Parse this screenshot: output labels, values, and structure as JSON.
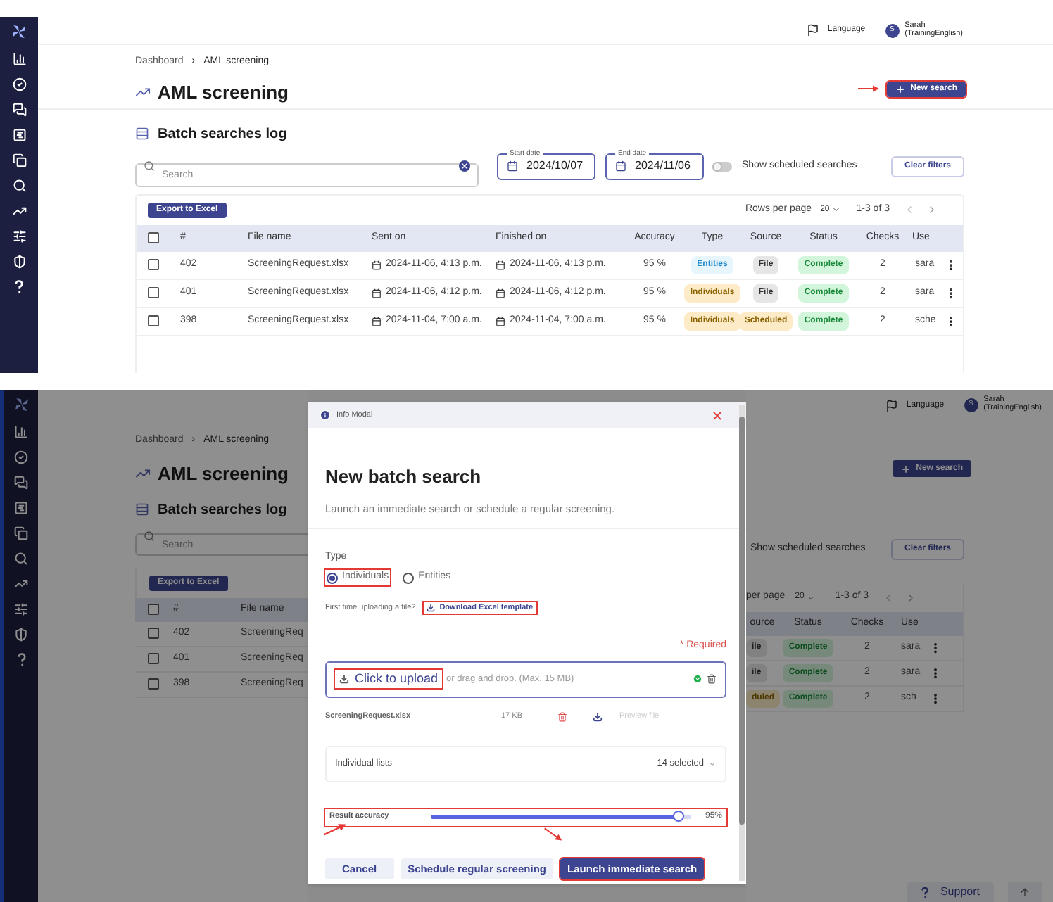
{
  "log_page": {
    "header": {
      "language": "Language",
      "user_initial": "S",
      "user_name": "Sarah",
      "user_org": "(TrainingEnglish)"
    },
    "breadcrumb": [
      "Dashboard",
      "›",
      "AML screening"
    ],
    "title": "AML screening",
    "new_search": {
      "label": "New search",
      "highlighted": true,
      "arrow": true
    },
    "section_title": "Batch searches log",
    "search": {
      "placeholder": "Search"
    },
    "start_date": {
      "label": "Start date",
      "value": "2024/10/07"
    },
    "end_date": {
      "label": "End date",
      "value": "2024/11/06"
    },
    "scheduled_toggle": {
      "label": "Show scheduled searches",
      "on": false
    },
    "clear_filters": "Clear filters",
    "export": "Export to Excel",
    "pagination": {
      "label": "Rows per page",
      "rows_per_page": "20",
      "range": "1-3 of 3"
    },
    "all_checked": false,
    "columns": [
      "#",
      "File name",
      "Sent on",
      "Finished on",
      "Accuracy",
      "Type",
      "Source",
      "Status",
      "Checks",
      "Use"
    ],
    "rows": [
      {
        "checked": false,
        "id": "402",
        "file": "ScreeningRequest.xlsx",
        "sent": "2024-11-06, 4:13 p.m.",
        "finished": "2024-11-06, 4:13 p.m.",
        "accuracy": "95 %",
        "type": {
          "label": "Entities",
          "kind": "entities"
        },
        "source": {
          "label": "File",
          "kind": "file"
        },
        "status": {
          "label": "Complete",
          "kind": "complete"
        },
        "checks": "2",
        "user": "sara"
      },
      {
        "checked": false,
        "id": "401",
        "file": "ScreeningRequest.xlsx",
        "sent": "2024-11-06, 4:12 p.m.",
        "finished": "2024-11-06, 4:12 p.m.",
        "accuracy": "95 %",
        "type": {
          "label": "Individuals",
          "kind": "individuals"
        },
        "source": {
          "label": "File",
          "kind": "file"
        },
        "status": {
          "label": "Complete",
          "kind": "complete"
        },
        "checks": "2",
        "user": "sara"
      },
      {
        "checked": false,
        "id": "398",
        "file": "ScreeningRequest.xlsx",
        "sent": "2024-11-04, 7:00 a.m.",
        "finished": "2024-11-04, 7:00 a.m.",
        "accuracy": "95 %",
        "type": {
          "label": "Individuals",
          "kind": "individuals"
        },
        "source": {
          "label": "Scheduled",
          "kind": "scheduled"
        },
        "status": {
          "label": "Complete",
          "kind": "complete"
        },
        "checks": "2",
        "user": "sche"
      }
    ]
  },
  "modal_view": {
    "left": {
      "breadcrumb": [
        "Dashboard",
        "›",
        "AML screening"
      ],
      "title": "AML screening",
      "section_title": "Batch searches log",
      "search": {
        "placeholder": "Search"
      },
      "export": "Export to Excel",
      "all_checked": false,
      "columns": [
        "#",
        "File name"
      ],
      "rows": [
        {
          "checked": false,
          "id": "402",
          "file": "ScreeningReq"
        },
        {
          "checked": false,
          "id": "401",
          "file": "ScreeningReq"
        },
        {
          "checked": false,
          "id": "398",
          "file": "ScreeningReq"
        }
      ]
    },
    "modal": {
      "header": "Info Modal",
      "title": "New batch search",
      "subtitle": "Launch an immediate search or schedule a regular screening.",
      "type_label": "Type",
      "types": [
        {
          "label": "Individuals",
          "selected": true,
          "highlighted": true
        },
        {
          "label": "Entities",
          "selected": false,
          "highlighted": false
        }
      ],
      "template_prompt": "First time uploading a file?",
      "template_link": {
        "label": "Download Excel template",
        "highlighted": true
      },
      "required": "* Required",
      "upload": {
        "link": "Click to upload",
        "highlighted": true,
        "hint": "or drag and drop. (Max. 15 MB)",
        "done": true
      },
      "file": {
        "name": "ScreeningRequest.xlsx",
        "size": "17 KB",
        "preview": "Preview file",
        "preview_disabled": true
      },
      "lists": {
        "label": "Individual lists",
        "value": "14 selected",
        "arrow": true
      },
      "accuracy": {
        "label": "Result accuracy",
        "level": 0.95,
        "reading": "95%",
        "highlighted": true
      },
      "buttons": [
        {
          "label": "Cancel",
          "kind": "plain",
          "highlighted": false,
          "arrow": false
        },
        {
          "label": "Schedule regular screening",
          "kind": "secondary",
          "highlighted": false,
          "arrow": false
        },
        {
          "label": "Launch immediate search",
          "kind": "primary",
          "highlighted": true,
          "arrow": true
        }
      ]
    },
    "right": {
      "header": {
        "language": "Language",
        "user_initial": "S",
        "user_name": "Sarah",
        "user_org": "(TrainingEnglish)"
      },
      "new_search": "New search",
      "toggle_label": "Show scheduled searches",
      "clear_filters": "Clear filters",
      "pagination": {
        "label": "per page",
        "rows_per_page": "20",
        "range": "1-3 of 3"
      },
      "columns": [
        "ource",
        "Status",
        "Checks",
        "Use"
      ],
      "rows": [
        {
          "source": {
            "label": "ile",
            "kind": "file"
          },
          "status": {
            "label": "Complete",
            "kind": "complete"
          },
          "checks": "2",
          "user": "sara"
        },
        {
          "source": {
            "label": "ile",
            "kind": "file"
          },
          "status": {
            "label": "Complete",
            "kind": "complete"
          },
          "checks": "2",
          "user": "sara"
        },
        {
          "source": {
            "label": "duled",
            "kind": "scheduled"
          },
          "status": {
            "label": "Complete",
            "kind": "complete"
          },
          "checks": "2",
          "user": "sch"
        }
      ],
      "support": "Support"
    }
  }
}
